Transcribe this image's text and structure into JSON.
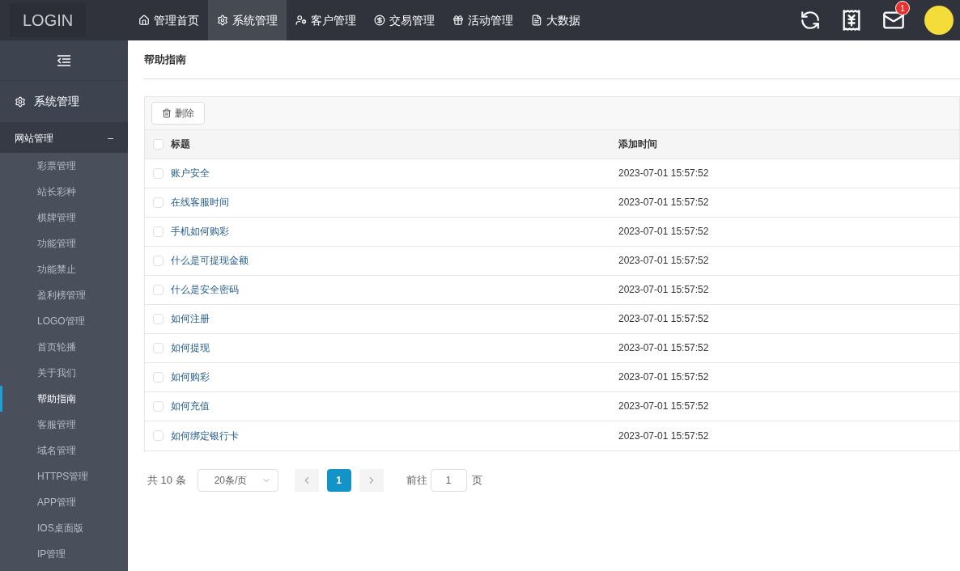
{
  "logo": "LOGIN",
  "nav": [
    {
      "label": "管理首页",
      "selected": false
    },
    {
      "label": "系统管理",
      "selected": true
    },
    {
      "label": "客户管理",
      "selected": false
    },
    {
      "label": "交易管理",
      "selected": false
    },
    {
      "label": "活动管理",
      "selected": false
    },
    {
      "label": "大数据",
      "selected": false
    }
  ],
  "header_actions": {
    "mail_badge": "1"
  },
  "sidebar": {
    "section": "系统管理",
    "group": {
      "label": "网站管理",
      "toggle": "–"
    },
    "items": [
      {
        "label": "彩票管理",
        "selected": false
      },
      {
        "label": "站长彩种",
        "selected": false
      },
      {
        "label": "棋牌管理",
        "selected": false
      },
      {
        "label": "功能管理",
        "selected": false
      },
      {
        "label": "功能禁止",
        "selected": false
      },
      {
        "label": "盈利榜管理",
        "selected": false
      },
      {
        "label": "LOGO管理",
        "selected": false
      },
      {
        "label": "首页轮播",
        "selected": false
      },
      {
        "label": "关于我们",
        "selected": false
      },
      {
        "label": "帮助指南",
        "selected": true
      },
      {
        "label": "客服管理",
        "selected": false
      },
      {
        "label": "域名管理",
        "selected": false
      },
      {
        "label": "HTTPS管理",
        "selected": false
      },
      {
        "label": "APP管理",
        "selected": false
      },
      {
        "label": "IOS桌面版",
        "selected": false
      },
      {
        "label": "IP管理",
        "selected": false
      }
    ]
  },
  "page_title": "帮助指南",
  "toolbar": {
    "delete": "删除"
  },
  "table": {
    "columns": [
      "标题",
      "添加时间"
    ],
    "all_checked": false,
    "rows": [
      {
        "title": "账户安全",
        "time": "2023-07-01 15:57:52",
        "checked": false
      },
      {
        "title": "在线客服时间",
        "time": "2023-07-01 15:57:52",
        "checked": false
      },
      {
        "title": "手机如何购彩",
        "time": "2023-07-01 15:57:52",
        "checked": false
      },
      {
        "title": "什么是可提现金额",
        "time": "2023-07-01 15:57:52",
        "checked": false
      },
      {
        "title": "什么是安全密码",
        "time": "2023-07-01 15:57:52",
        "checked": false
      },
      {
        "title": "如何注册",
        "time": "2023-07-01 15:57:52",
        "checked": false
      },
      {
        "title": "如何提现",
        "time": "2023-07-01 15:57:52",
        "checked": false
      },
      {
        "title": "如何购彩",
        "time": "2023-07-01 15:57:52",
        "checked": false
      },
      {
        "title": "如何充值",
        "time": "2023-07-01 15:57:52",
        "checked": false
      },
      {
        "title": "如何绑定银行卡",
        "time": "2023-07-01 15:57:52",
        "checked": false
      }
    ]
  },
  "pagination": {
    "total": "共 10 条",
    "page_size": "20条/页",
    "pages": [
      {
        "label": "1",
        "selected": true
      }
    ],
    "goto_label": "前往",
    "goto_value": "1",
    "goto_suffix": "页"
  }
}
